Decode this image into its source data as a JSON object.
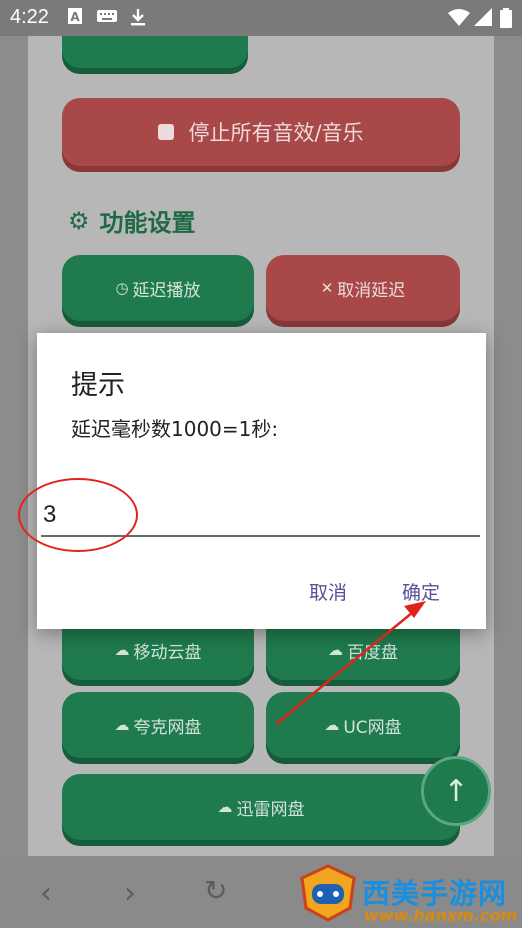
{
  "status_bar": {
    "time": "4:22"
  },
  "content": {
    "stop_button": "停止所有音效/音乐",
    "section_title": "功能设置",
    "delay_play": "延迟播放",
    "cancel_delay": "取消延迟",
    "mobile_cloud": "移动云盘",
    "baidu_pan": "百度盘",
    "quark_pan": "夸克网盘",
    "uc_pan": "UC网盘",
    "xunlei_pan": "迅雷网盘"
  },
  "dialog": {
    "title": "提示",
    "message": "延迟毫秒数1000=1秒:",
    "input_value": "3",
    "cancel_label": "取消",
    "confirm_label": "确定"
  },
  "watermark": {
    "title": "西美手游网",
    "url": "www.hanxm.com"
  },
  "colors": {
    "accent_green": "#1f7a4d",
    "danger_red": "#a94848",
    "dialog_button": "#5b4f96",
    "annotation": "#e0241b"
  }
}
